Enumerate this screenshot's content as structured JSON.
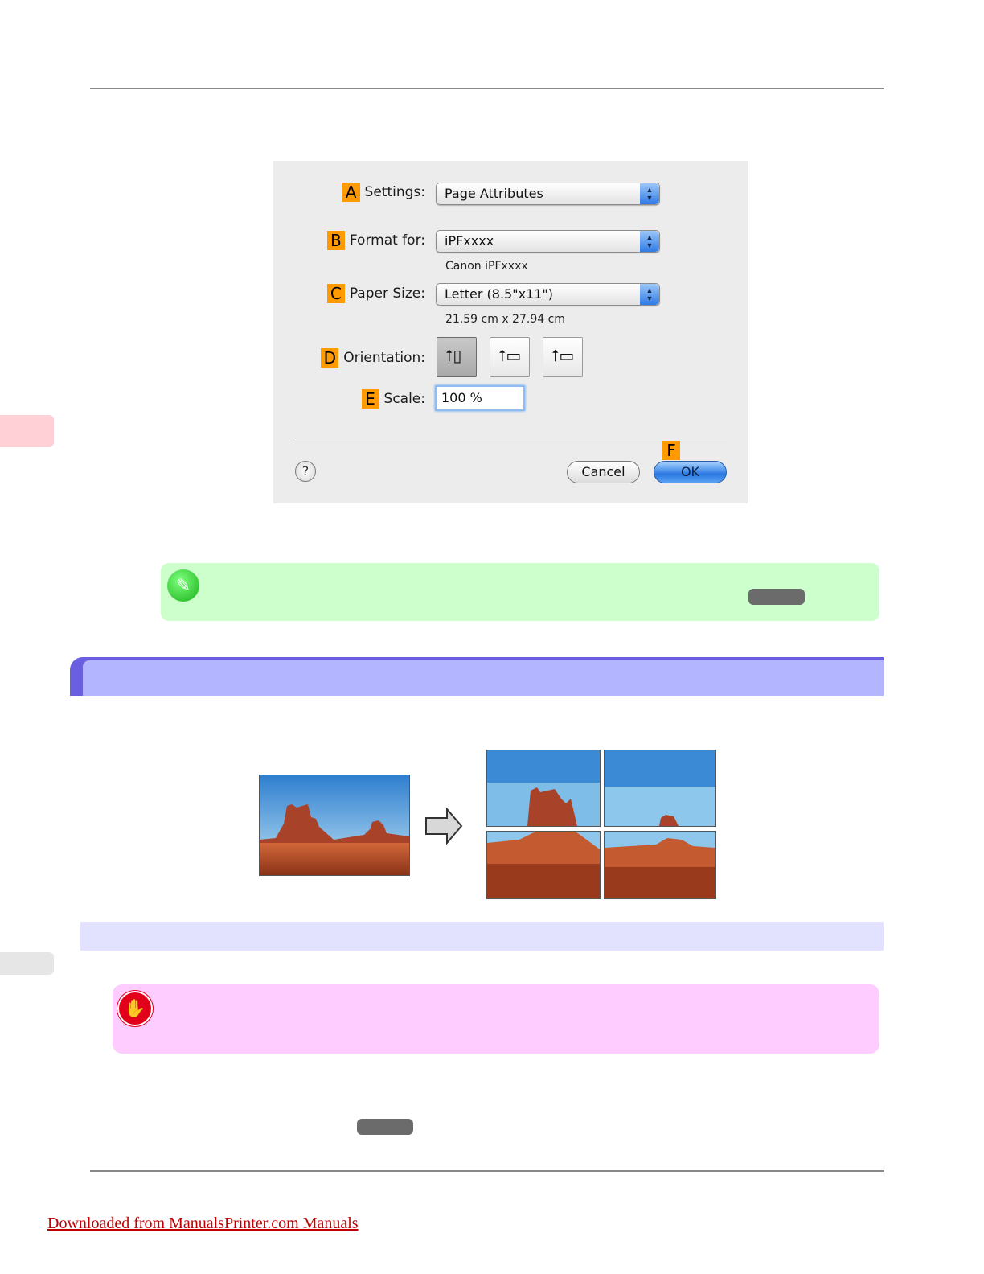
{
  "dialog": {
    "rows": {
      "settings": {
        "badge": "A",
        "label": "Settings:",
        "value": "Page Attributes"
      },
      "format": {
        "badge": "B",
        "label": "Format for:",
        "value": "iPFxxxx",
        "sub": "Canon iPFxxxx"
      },
      "paper": {
        "badge": "C",
        "label": "Paper Size:",
        "value": "Letter (8.5\"x11\")",
        "sub": "21.59 cm x 27.94 cm"
      },
      "orientation": {
        "badge": "D",
        "label": "Orientation:"
      },
      "scale": {
        "badge": "E",
        "label": "Scale:",
        "value": "100 %"
      }
    },
    "ok_badge": "F",
    "help": "?",
    "cancel": "Cancel",
    "ok": "OK"
  },
  "footer": {
    "link": "Downloaded from ManualsPrinter.com Manuals"
  },
  "colors": {
    "badge": "#ff9a00",
    "note_bg": "#ccffcc",
    "important_bg": "#ffccff",
    "section_bar": "#6a5fe0",
    "section_fill": "#b3b6ff",
    "subbar": "#e2e2ff",
    "link": "#c00000"
  },
  "icons": {
    "note": "pencil-note-icon",
    "important": "hand-stop-icon",
    "arrow": "right-arrow-icon"
  }
}
